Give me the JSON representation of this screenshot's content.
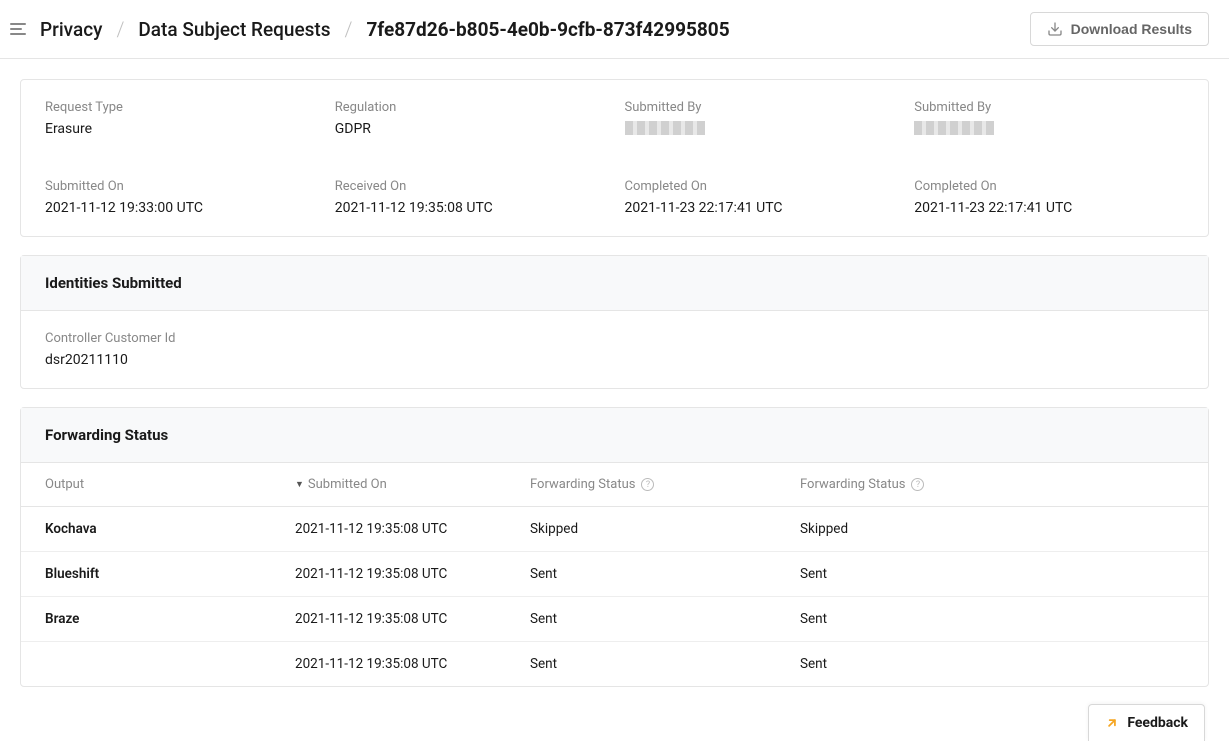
{
  "breadcrumb": {
    "level1": "Privacy",
    "level2": "Data Subject Requests",
    "current": "7fe87d26-b805-4e0b-9cfb-873f42995805"
  },
  "actions": {
    "download_label": "Download Results"
  },
  "details": {
    "request_type_label": "Request Type",
    "request_type_value": "Erasure",
    "regulation_label": "Regulation",
    "regulation_value": "GDPR",
    "submitted_by_label_1": "Submitted By",
    "submitted_by_label_2": "Submitted By",
    "submitted_on_label": "Submitted On",
    "submitted_on_value": "2021-11-12 19:33:00 UTC",
    "received_on_label": "Received On",
    "received_on_value": "2021-11-12 19:35:08 UTC",
    "completed_on_label_1": "Completed On",
    "completed_on_value_1": "2021-11-23 22:17:41 UTC",
    "completed_on_label_2": "Completed On",
    "completed_on_value_2": "2021-11-23 22:17:41 UTC"
  },
  "identities": {
    "section_title": "Identities Submitted",
    "controller_label": "Controller Customer Id",
    "controller_value": "dsr20211110"
  },
  "forwarding": {
    "section_title": "Forwarding Status",
    "headers": {
      "output": "Output",
      "submitted_on": "Submitted On",
      "status1": "Forwarding Status",
      "status2": "Forwarding Status"
    },
    "rows": [
      {
        "output": "Kochava",
        "submitted_on": "2021-11-12 19:35:08 UTC",
        "status1": "Skipped",
        "status2": "Skipped"
      },
      {
        "output": "Blueshift",
        "submitted_on": "2021-11-12 19:35:08 UTC",
        "status1": "Sent",
        "status2": "Sent"
      },
      {
        "output": "Braze",
        "submitted_on": "2021-11-12 19:35:08 UTC",
        "status1": "Sent",
        "status2": "Sent"
      },
      {
        "output": "",
        "submitted_on": "2021-11-12 19:35:08 UTC",
        "status1": "Sent",
        "status2": "Sent"
      }
    ]
  },
  "feedback": {
    "label": "Feedback"
  }
}
